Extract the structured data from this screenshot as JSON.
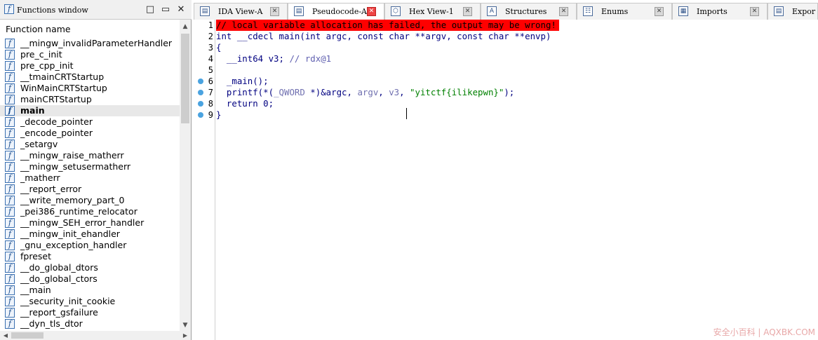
{
  "functions_window": {
    "title": "Functions window",
    "minimize": "□",
    "restore": "▭",
    "close": "✕",
    "column_header": "Function name",
    "items": [
      "__mingw_invalidParameterHandler",
      "pre_c_init",
      "pre_cpp_init",
      "__tmainCRTStartup",
      "WinMainCRTStartup",
      "mainCRTStartup",
      "main",
      "_decode_pointer",
      "_encode_pointer",
      "_setargv",
      "__mingw_raise_matherr",
      "__mingw_setusermatherr",
      "_matherr",
      "__report_error",
      "__write_memory_part_0",
      "_pei386_runtime_relocator",
      "__mingw_SEH_error_handler",
      "__mingw_init_ehandler",
      "_gnu_exception_handler",
      "fpreset",
      "__do_global_dtors",
      "__do_global_ctors",
      "__main",
      "__security_init_cookie",
      "__report_gsfailure",
      "__dyn_tls_dtor"
    ],
    "selected_index": 6,
    "icon_glyph": "f"
  },
  "tabs": [
    {
      "label": "IDA View-A",
      "icon": "▤",
      "active": false
    },
    {
      "label": "Pseudocode-A",
      "icon": "▤",
      "active": true
    },
    {
      "label": "Hex View-1",
      "icon": "⬡",
      "active": false
    },
    {
      "label": "Structures",
      "icon": "A",
      "active": false
    },
    {
      "label": "Enums",
      "icon": "☷",
      "active": false
    },
    {
      "label": "Imports",
      "icon": "▦",
      "active": false
    },
    {
      "label": "Expor",
      "icon": "▤",
      "active": false
    }
  ],
  "tab_close_glyph": "✕",
  "code": {
    "line_numbers": [
      "1",
      "2",
      "3",
      "4",
      "5",
      "6",
      "7",
      "8",
      "9"
    ],
    "breakpoint_lines": [
      6,
      7,
      8,
      9
    ],
    "lines": {
      "l1": "// local variable allocation has failed, the output may be wrong!",
      "l2": "int __cdecl main(int argc, const char **argv, const char **envp)",
      "l3": "{",
      "l4_type": "  __int64 v3; ",
      "l4_cmt": "// rdx@1",
      "l5": "",
      "l6": "  _main();",
      "l7_a": "  printf(*(",
      "l7_qword": "_QWORD",
      "l7_b": " *)&argc, ",
      "l7_argv": "argv",
      "l7_c": ", ",
      "l7_v3": "v3",
      "l7_d": ", ",
      "l7_str": "\"yitctf{ilikepwn}\"",
      "l7_e": ");",
      "l8": "  return 0;",
      "l9": "}"
    }
  },
  "watermark": "安全小百科 | AQXBK.COM"
}
